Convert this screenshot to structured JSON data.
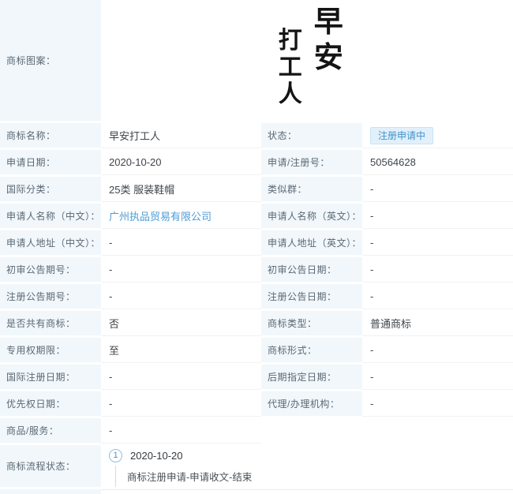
{
  "colors": {
    "label_bg": "#F1F7FB",
    "label_text": "#5C6873",
    "value_text": "#3F4449",
    "link": "#4D9CD3",
    "badge_bg": "#E1F0FA",
    "badge_text": "#4193CC",
    "badge_border": "#C9E3F4",
    "row_border": "#F2F2F2",
    "flow_line": "#D5DBDF",
    "flow_circle_border": "#8CC1E4"
  },
  "image_row": {
    "label": "商标图案：",
    "art_left_column": "打工人",
    "art_right_column": "早安"
  },
  "table": {
    "rows": [
      {
        "l": {
          "label": "商标名称：",
          "value": "早安打工人",
          "type": "text"
        },
        "r": {
          "label": "状态：",
          "value": "注册申请中",
          "type": "badge"
        }
      },
      {
        "l": {
          "label": "申请日期：",
          "value": "2020-10-20",
          "type": "text"
        },
        "r": {
          "label": "申请/注册号：",
          "value": "50564628",
          "type": "text"
        }
      },
      {
        "l": {
          "label": "国际分类：",
          "value": "25类 服装鞋帽",
          "type": "text"
        },
        "r": {
          "label": "类似群：",
          "value": "-",
          "type": "text"
        }
      },
      {
        "l": {
          "label": "申请人名称（中文）：",
          "value": "广州执品贸易有限公司",
          "type": "link"
        },
        "r": {
          "label": "申请人名称（英文）：",
          "value": "-",
          "type": "text"
        }
      },
      {
        "l": {
          "label": "申请人地址（中文）：",
          "value": "-",
          "type": "text"
        },
        "r": {
          "label": "申请人地址（英文）：",
          "value": "-",
          "type": "text"
        }
      },
      {
        "l": {
          "label": "初审公告期号：",
          "value": "-",
          "type": "text"
        },
        "r": {
          "label": "初审公告日期：",
          "value": "-",
          "type": "text"
        }
      },
      {
        "l": {
          "label": "注册公告期号：",
          "value": "-",
          "type": "text"
        },
        "r": {
          "label": "注册公告日期：",
          "value": "-",
          "type": "text"
        }
      },
      {
        "l": {
          "label": "是否共有商标：",
          "value": "否",
          "type": "text"
        },
        "r": {
          "label": "商标类型：",
          "value": "普通商标",
          "type": "text"
        }
      },
      {
        "l": {
          "label": "专用权期限：",
          "value": "至",
          "type": "text"
        },
        "r": {
          "label": "商标形式：",
          "value": "-",
          "type": "text"
        }
      },
      {
        "l": {
          "label": "国际注册日期：",
          "value": "-",
          "type": "text"
        },
        "r": {
          "label": "后期指定日期：",
          "value": "-",
          "type": "text"
        }
      },
      {
        "l": {
          "label": "优先权日期：",
          "value": "-",
          "type": "text"
        },
        "r": {
          "label": "代理/办理机构：",
          "value": "-",
          "type": "text"
        }
      },
      {
        "l": {
          "label": "商品/服务：",
          "value": "-",
          "type": "text"
        },
        "r": {
          "type": "none"
        }
      }
    ]
  },
  "flow": {
    "label": "商标流程状态：",
    "steps": [
      {
        "num": "1",
        "date": "2020-10-20",
        "desc": "商标注册申请-申请收文-结束"
      }
    ]
  }
}
